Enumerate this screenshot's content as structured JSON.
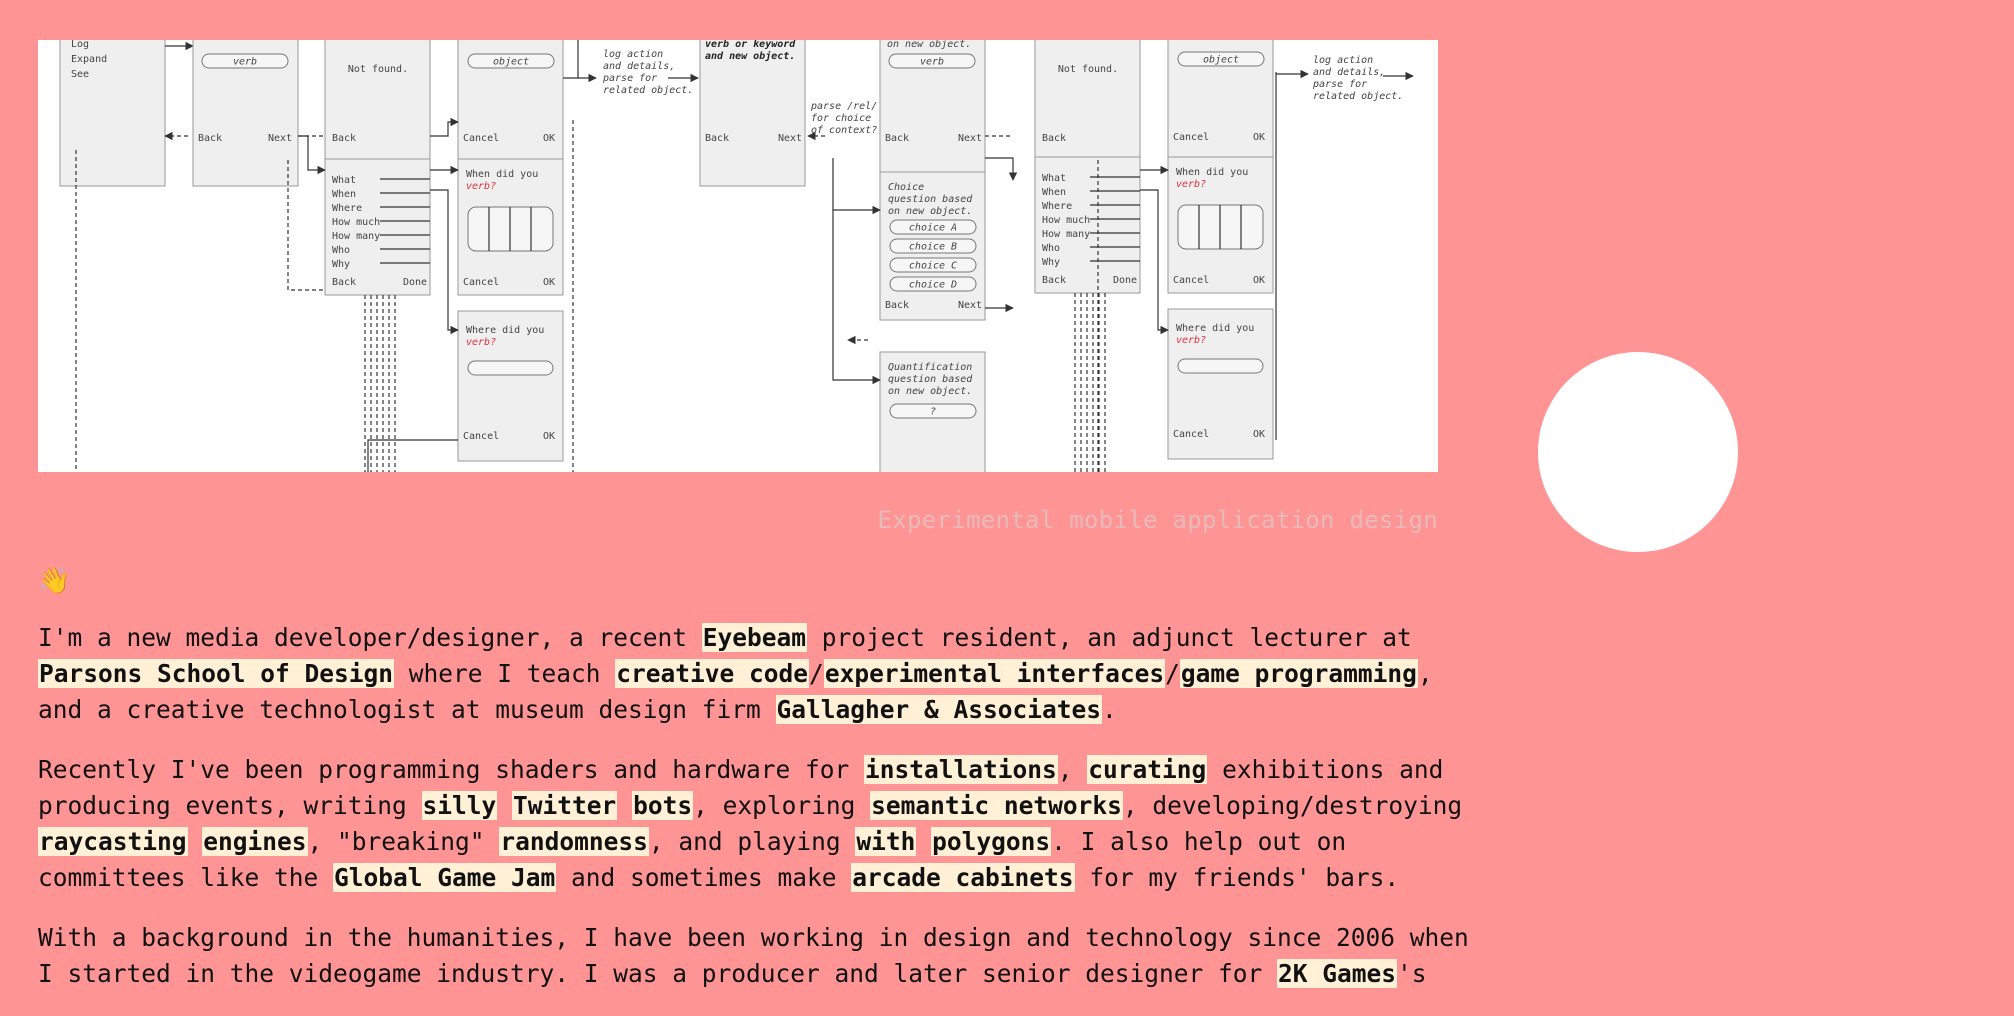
{
  "hero": {
    "caption": "Experimental mobile application design",
    "diagram": {
      "left_panel_menu": [
        "Log",
        "Expand",
        "See"
      ],
      "question_words": [
        "What",
        "When",
        "Where",
        "How much",
        "How many",
        "Who",
        "Why"
      ],
      "choices": [
        "choice A",
        "choice B",
        "choice C",
        "choice D"
      ],
      "labels": {
        "verb": "verb",
        "object": "object",
        "not_found": "Not found.",
        "back": "Back",
        "next": "Next",
        "cancel": "Cancel",
        "ok": "OK",
        "done": "Done",
        "log_action": "log action",
        "and_details": "and details,",
        "parse_for": "parse for",
        "related_object": "related object.",
        "verb_keyword_1": "verb or keyword",
        "verb_keyword_2": "and new object.",
        "parse_rel_1": "parse /rel/",
        "parse_rel_2": "for choice",
        "parse_rel_3": "of context?",
        "on_new_object": "on new object.",
        "when_did_you": "When did you",
        "where_did_you": "Where did you",
        "verb_q": "verb?",
        "choice_q_1": "Choice",
        "choice_q_2": "question based",
        "choice_q_3": "on new object.",
        "quant_q_1": "Quantification",
        "quant_q_2": "question based",
        "quant_q_3": "on new object.",
        "question_mark": "?"
      }
    }
  },
  "intro": {
    "emoji": "👋",
    "p1": {
      "t1": "I'm a new media developer/designer, a recent ",
      "l1": "Eyebeam",
      "t2": " project resident, an adjunct lecturer at ",
      "l2": "Parsons School of Design",
      "t3": " where I teach ",
      "l3": "creative code",
      "t4": "/",
      "l4": "experimental interfaces",
      "t5": "/",
      "l5": "game programming",
      "t6": ", and a creative technologist at museum design firm ",
      "l6": "Gallagher & Associates",
      "t7": "."
    },
    "p2": {
      "t1": "Recently I've been programming shaders and hardware for ",
      "l1": "installations",
      "t2": ", ",
      "l2": "curating",
      "t3": " exhibitions and producing events, writing ",
      "l3": "silly",
      "t4": " ",
      "l4": "Twitter",
      "t5": " ",
      "l5": "bots",
      "t6": ", exploring ",
      "l6": "semantic networks",
      "t7": ", developing/destroying ",
      "l7": "raycasting",
      "t8": " ",
      "l8": "engines",
      "t9": ", \"breaking\" ",
      "l9": "randomness",
      "t10": ", and playing ",
      "l10": "with",
      "t11": " ",
      "l11": "polygons",
      "t12": ". I also help out on committees like the ",
      "l12": "Global Game Jam",
      "t13": " and sometimes make ",
      "l13": "arcade cabinets",
      "t14": " for my friends' bars."
    },
    "p3": {
      "t1": "With a background in the humanities, I have been working in design and technology since 2006 when I started in the videogame industry. I was a producer and later senior designer for ",
      "l1": "2K Games",
      "t2": "'s"
    }
  },
  "colors": {
    "background": "#ff9494",
    "highlight": "#fff0d6",
    "caption": "#e8b9b9",
    "accent_red": "#e0313a"
  }
}
